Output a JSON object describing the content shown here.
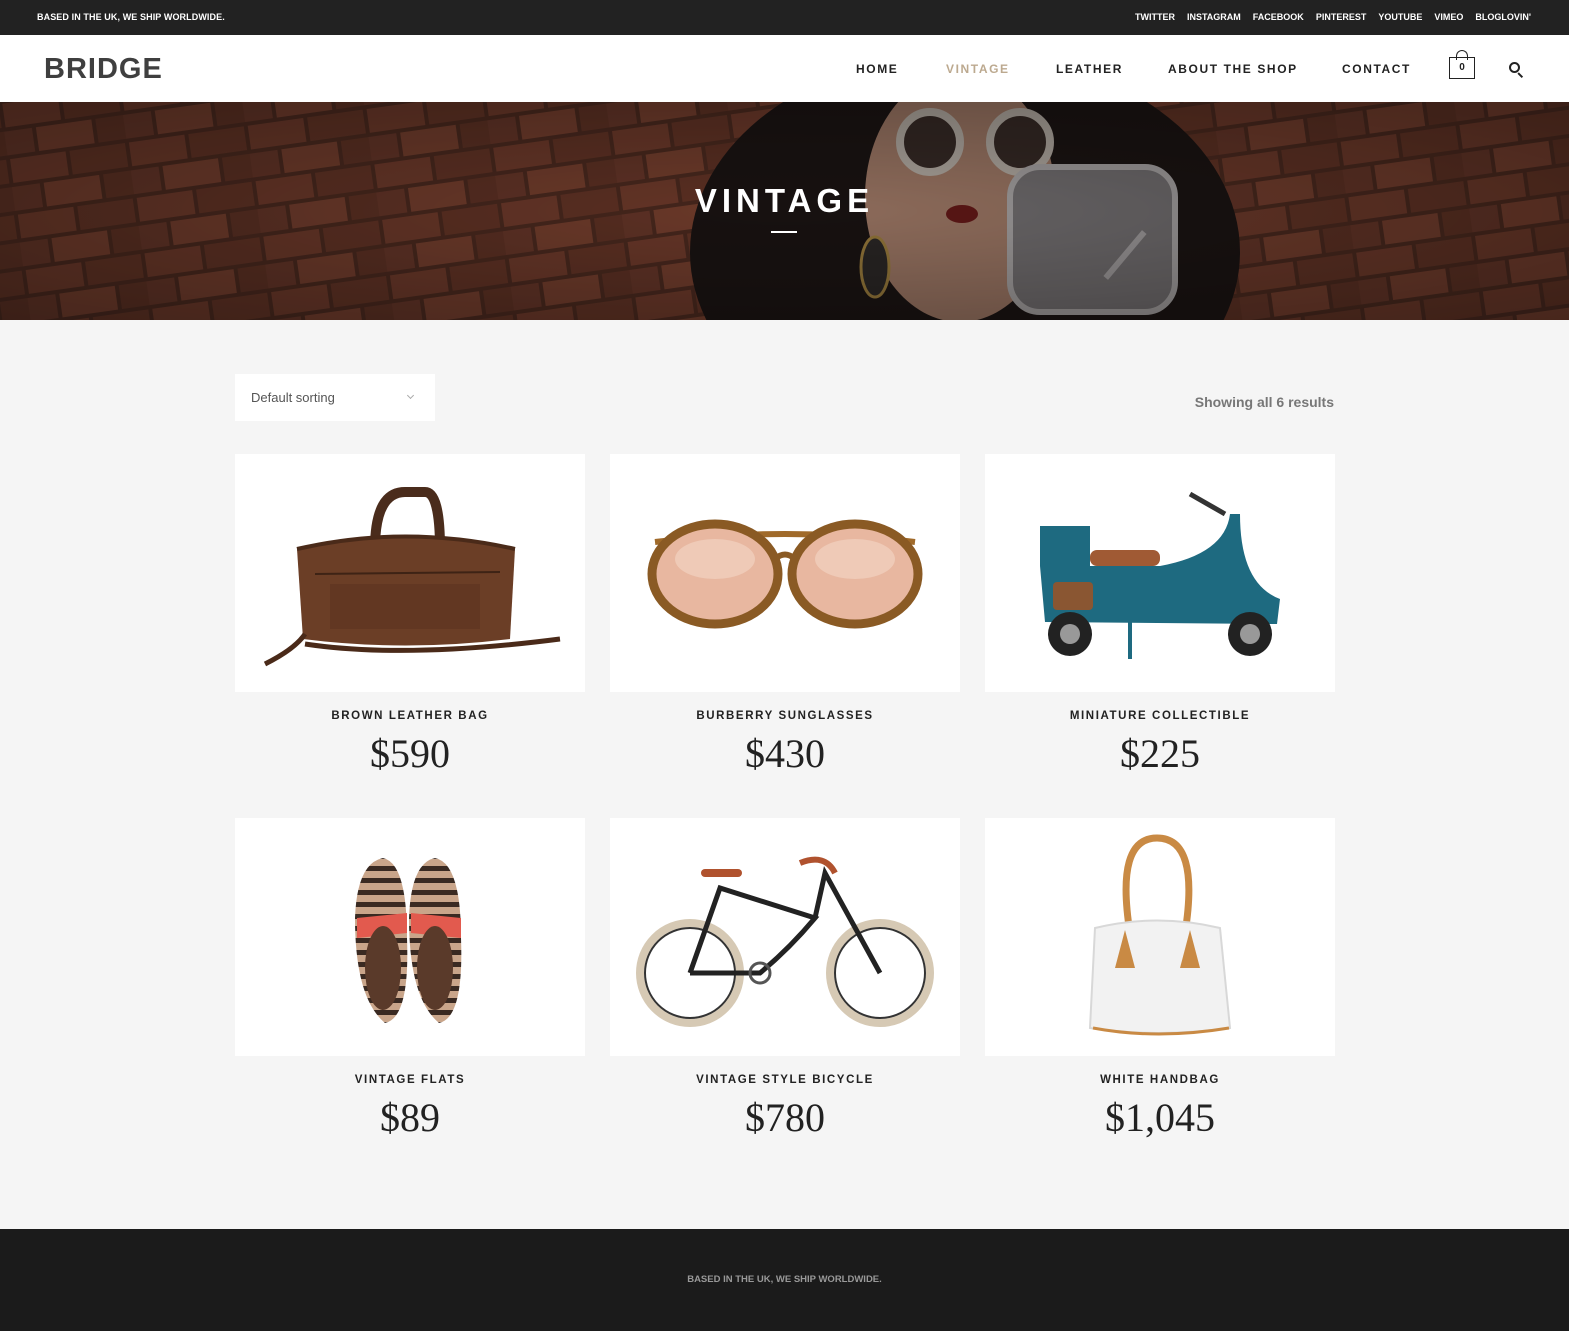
{
  "topbar": {
    "tagline": "BASED IN THE UK, WE SHIP WORLDWIDE.",
    "social": [
      "TWITTER",
      "INSTAGRAM",
      "FACEBOOK",
      "PINTEREST",
      "YOUTUBE",
      "VIMEO",
      "BLOGLOVIN'"
    ]
  },
  "header": {
    "logo": "BRIDGE",
    "nav": {
      "home": "HOME",
      "vintage": "VINTAGE",
      "leather": "LEATHER",
      "about": "ABOUT THE SHOP",
      "contact": "CONTACT"
    },
    "cart_count": "0",
    "active_color": "#bca98f"
  },
  "hero": {
    "title": "VINTAGE"
  },
  "shop": {
    "sort_label": "Default sorting",
    "results_text": "Showing all 6 results"
  },
  "products": [
    {
      "name": "BROWN LEATHER BAG",
      "price": "$590",
      "icon": "leather-bag"
    },
    {
      "name": "BURBERRY SUNGLASSES",
      "price": "$430",
      "icon": "sunglasses"
    },
    {
      "name": "MINIATURE COLLECTIBLE",
      "price": "$225",
      "icon": "scooter"
    },
    {
      "name": "VINTAGE FLATS",
      "price": "$89",
      "icon": "flats"
    },
    {
      "name": "VINTAGE STYLE BICYCLE",
      "price": "$780",
      "icon": "bicycle"
    },
    {
      "name": "WHITE HANDBAG",
      "price": "$1,045",
      "icon": "handbag"
    }
  ],
  "footer": {
    "tagline": "BASED IN THE UK, WE SHIP WORLDWIDE."
  }
}
